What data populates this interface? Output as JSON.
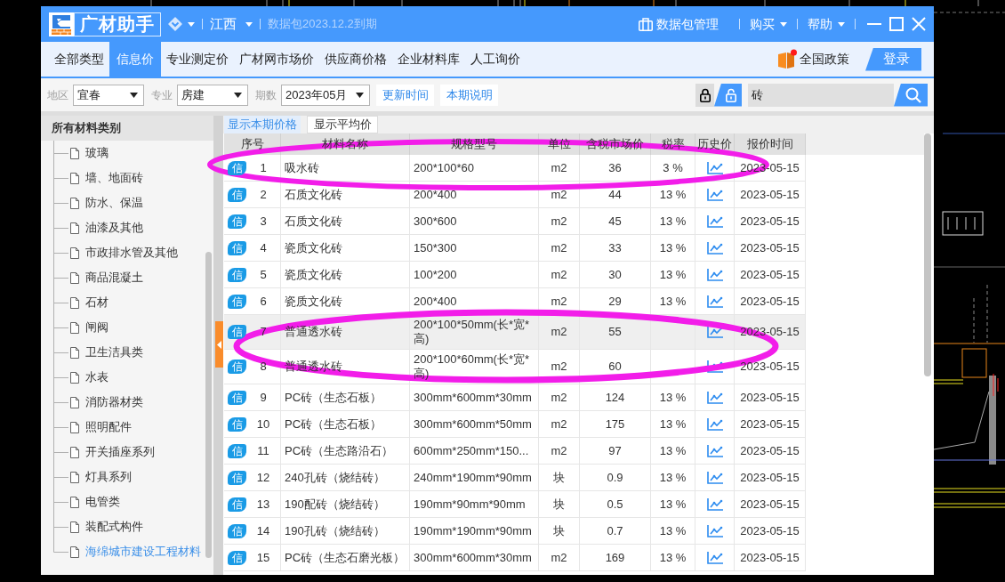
{
  "title_bar": {
    "app_name": "广材助手",
    "region": "江西",
    "expiry_notice": "数据包2023.12.2到期",
    "actions": [
      {
        "label": "数据包管理",
        "kind": "package"
      },
      {
        "label": "购买",
        "kind": "dropdown"
      },
      {
        "label": "帮助",
        "kind": "dropdown"
      }
    ]
  },
  "nav_tabs": [
    {
      "label": "全部类型",
      "selected": false
    },
    {
      "label": "信息价",
      "selected": true
    },
    {
      "label": "专业测定价",
      "selected": false
    },
    {
      "label": "广材网市场价",
      "selected": false
    },
    {
      "label": "供应商价格",
      "selected": false
    },
    {
      "label": "企业材料库",
      "selected": false
    },
    {
      "label": "人工询价",
      "selected": false
    }
  ],
  "policy_link": "全国政策",
  "login_button": "登录",
  "filters": [
    {
      "label": "地区",
      "value": "宜春"
    },
    {
      "label": "专业",
      "value": "房建"
    },
    {
      "label": "期数",
      "value": "2023年05月"
    }
  ],
  "filter_buttons": [
    "更新时间",
    "本期说明"
  ],
  "lock_toggle": [
    {
      "kind": "locked",
      "selected": false
    },
    {
      "kind": "unlocked",
      "selected": true
    }
  ],
  "search": {
    "value": "砖"
  },
  "sidebar": {
    "title": "所有材料类别",
    "items": [
      {
        "label": "玻璃",
        "selected": false
      },
      {
        "label": "墙、地面砖",
        "selected": false
      },
      {
        "label": "防水、保温",
        "selected": false
      },
      {
        "label": "油漆及其他",
        "selected": false
      },
      {
        "label": "市政排水管及其他",
        "selected": false
      },
      {
        "label": "商品混凝土",
        "selected": false
      },
      {
        "label": "石材",
        "selected": false
      },
      {
        "label": "闸阀",
        "selected": false
      },
      {
        "label": "卫生洁具类",
        "selected": false
      },
      {
        "label": "水表",
        "selected": false
      },
      {
        "label": "消防器材类",
        "selected": false
      },
      {
        "label": "照明配件",
        "selected": false
      },
      {
        "label": "开关插座系列",
        "selected": false
      },
      {
        "label": "灯具系列",
        "selected": false
      },
      {
        "label": "电管类",
        "selected": false
      },
      {
        "label": "装配式构件",
        "selected": false
      },
      {
        "label": "海绵城市建设工程材料",
        "selected": true
      }
    ]
  },
  "view_tabs": [
    {
      "label": "显示本期价格",
      "selected": true
    },
    {
      "label": "显示平均价",
      "selected": false
    }
  ],
  "table": {
    "columns": [
      "序号",
      "材料名称",
      "规格型号",
      "单位",
      "含税市场价",
      "税率",
      "历史价",
      "报价时间"
    ],
    "rows": [
      {
        "tag": "信",
        "no": "1",
        "name": "吸水砖",
        "spec": "200*100*60",
        "unit": "m2",
        "price": "36",
        "tax": "3 %",
        "date": "2023-05-15",
        "highlighted": false
      },
      {
        "tag": "信",
        "no": "2",
        "name": "石质文化砖",
        "spec": "200*400",
        "unit": "m2",
        "price": "44",
        "tax": "13 %",
        "date": "2023-05-15",
        "highlighted": false
      },
      {
        "tag": "信",
        "no": "3",
        "name": "石质文化砖",
        "spec": "300*600",
        "unit": "m2",
        "price": "45",
        "tax": "13 %",
        "date": "2023-05-15",
        "highlighted": false
      },
      {
        "tag": "信",
        "no": "4",
        "name": "瓷质文化砖",
        "spec": "150*300",
        "unit": "m2",
        "price": "33",
        "tax": "13 %",
        "date": "2023-05-15",
        "highlighted": false
      },
      {
        "tag": "信",
        "no": "5",
        "name": "瓷质文化砖",
        "spec": "100*200",
        "unit": "m2",
        "price": "30",
        "tax": "13 %",
        "date": "2023-05-15",
        "highlighted": false
      },
      {
        "tag": "信",
        "no": "6",
        "name": "瓷质文化砖",
        "spec": "200*400",
        "unit": "m2",
        "price": "29",
        "tax": "13 %",
        "date": "2023-05-15",
        "highlighted": false
      },
      {
        "tag": "信",
        "no": "7",
        "name": "普通透水砖",
        "spec": "200*100*50mm(长*宽*高)",
        "unit": "m2",
        "price": "55",
        "date": "2023-05-15",
        "highlighted": true
      },
      {
        "tag": "信",
        "no": "8",
        "name": "普通透水砖",
        "spec": "200*100*60mm(长*宽*高)",
        "unit": "m2",
        "price": "60",
        "date": "2023-05-15",
        "highlighted": false
      },
      {
        "tag": "信",
        "no": "9",
        "name": "PC砖（生态石板）",
        "spec": "300mm*600mm*30mm",
        "unit": "m2",
        "price": "124",
        "tax": "13 %",
        "date": "2023-05-15",
        "highlighted": false
      },
      {
        "tag": "信",
        "no": "10",
        "name": "PC砖（生态石板）",
        "spec": "300mm*600mm*50mm",
        "unit": "m2",
        "price": "175",
        "tax": "13 %",
        "date": "2023-05-15",
        "highlighted": false
      },
      {
        "tag": "信",
        "no": "11",
        "name": "PC砖（生态路沿石）",
        "spec": "600mm*250mm*150...",
        "unit": "m2",
        "price": "97",
        "tax": "13 %",
        "date": "2023-05-15",
        "highlighted": false
      },
      {
        "tag": "信",
        "no": "12",
        "name": "240孔砖（烧结砖）",
        "spec": "240mm*190mm*90mm",
        "unit": "块",
        "price": "0.9",
        "tax": "13 %",
        "date": "2023-05-15",
        "highlighted": false
      },
      {
        "tag": "信",
        "no": "13",
        "name": "190配砖（烧结砖）",
        "spec": "190mm*90mm*90mm",
        "unit": "块",
        "price": "0.5",
        "tax": "13 %",
        "date": "2023-05-15",
        "highlighted": false
      },
      {
        "tag": "信",
        "no": "14",
        "name": "190孔砖（烧结砖）",
        "spec": "190mm*190mm*90mm",
        "unit": "块",
        "price": "0.7",
        "tax": "13 %",
        "date": "2023-05-15",
        "highlighted": false
      },
      {
        "tag": "信",
        "no": "15",
        "name": "PC砖（生态石磨光板）",
        "spec": "300mm*600mm*30mm",
        "unit": "m2",
        "price": "169",
        "tax": "13 %",
        "date": "2023-05-15",
        "highlighted": false
      }
    ]
  }
}
